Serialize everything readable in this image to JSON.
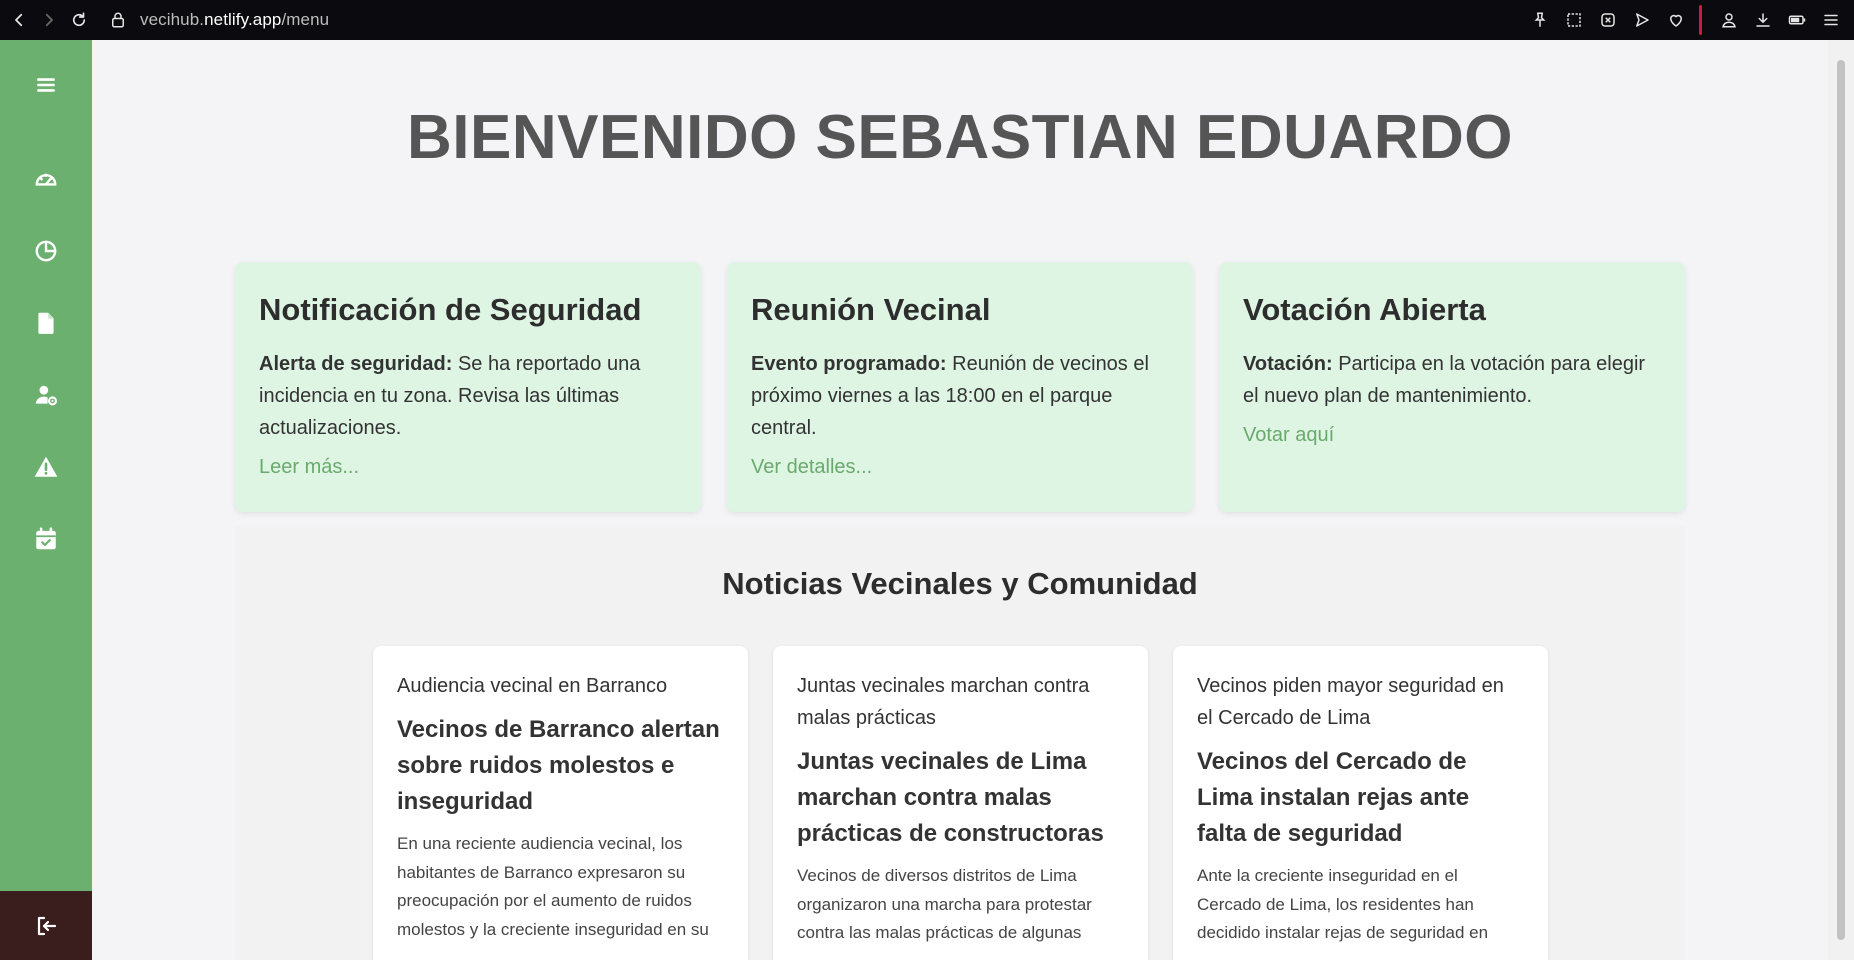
{
  "browser": {
    "url_host": "vecihub.netlify.app",
    "url_path": "/menu",
    "url_prefix": "vecihub."
  },
  "main": {
    "welcome": "BIENVENIDO SEBASTIAN EDUARDO",
    "cards": [
      {
        "title": "Notificación de Seguridad",
        "label": "Alerta de seguridad:",
        "text": " Se ha reportado una incidencia en tu zona. Revisa las últimas actualizaciones.",
        "link": "Leer más..."
      },
      {
        "title": "Reunión Vecinal",
        "label": "Evento programado:",
        "text": " Reunión de vecinos el próximo viernes a las 18:00 en el parque central.",
        "link": "Ver detalles..."
      },
      {
        "title": "Votación Abierta",
        "label": "Votación:",
        "text": " Participa en la votación para elegir el nuevo plan de mantenimiento.",
        "link": "Votar aquí"
      }
    ],
    "news_title": "Noticias Vecinales y Comunidad",
    "news": [
      {
        "image_alt": "Audiencia vecinal en Barranco",
        "title": "Vecinos de Barranco alertan sobre ruidos molestos e inseguridad",
        "text": "En una reciente audiencia vecinal, los habitantes de Barranco expresaron su preocupación por el aumento de ruidos molestos y la creciente inseguridad en su"
      },
      {
        "image_alt": "Juntas vecinales marchan contra malas prácticas",
        "title": "Juntas vecinales de Lima marchan contra malas prácticas de constructoras",
        "text": "Vecinos de diversos distritos de Lima organizaron una marcha para protestar contra las malas prácticas de algunas"
      },
      {
        "image_alt": "Vecinos piden mayor seguridad en el Cercado de Lima",
        "title": "Vecinos del Cercado de Lima instalan rejas ante falta de seguridad",
        "text": "Ante la creciente inseguridad en el Cercado de Lima, los residentes han decidido instalar rejas de seguridad en"
      }
    ]
  },
  "sidebar": {
    "items": [
      {
        "icon": "menu-icon"
      },
      {
        "icon": "dashboard-icon"
      },
      {
        "icon": "pie-chart-icon"
      },
      {
        "icon": "document-icon"
      },
      {
        "icon": "user-settings-icon"
      },
      {
        "icon": "warning-icon"
      },
      {
        "icon": "calendar-icon"
      }
    ],
    "logout_icon": "logout-icon"
  },
  "colors": {
    "sidebar": "#6cb06f",
    "logout_bg": "#3a1d1d",
    "card_bg": "#def5e4",
    "link": "#6aaa6d"
  }
}
